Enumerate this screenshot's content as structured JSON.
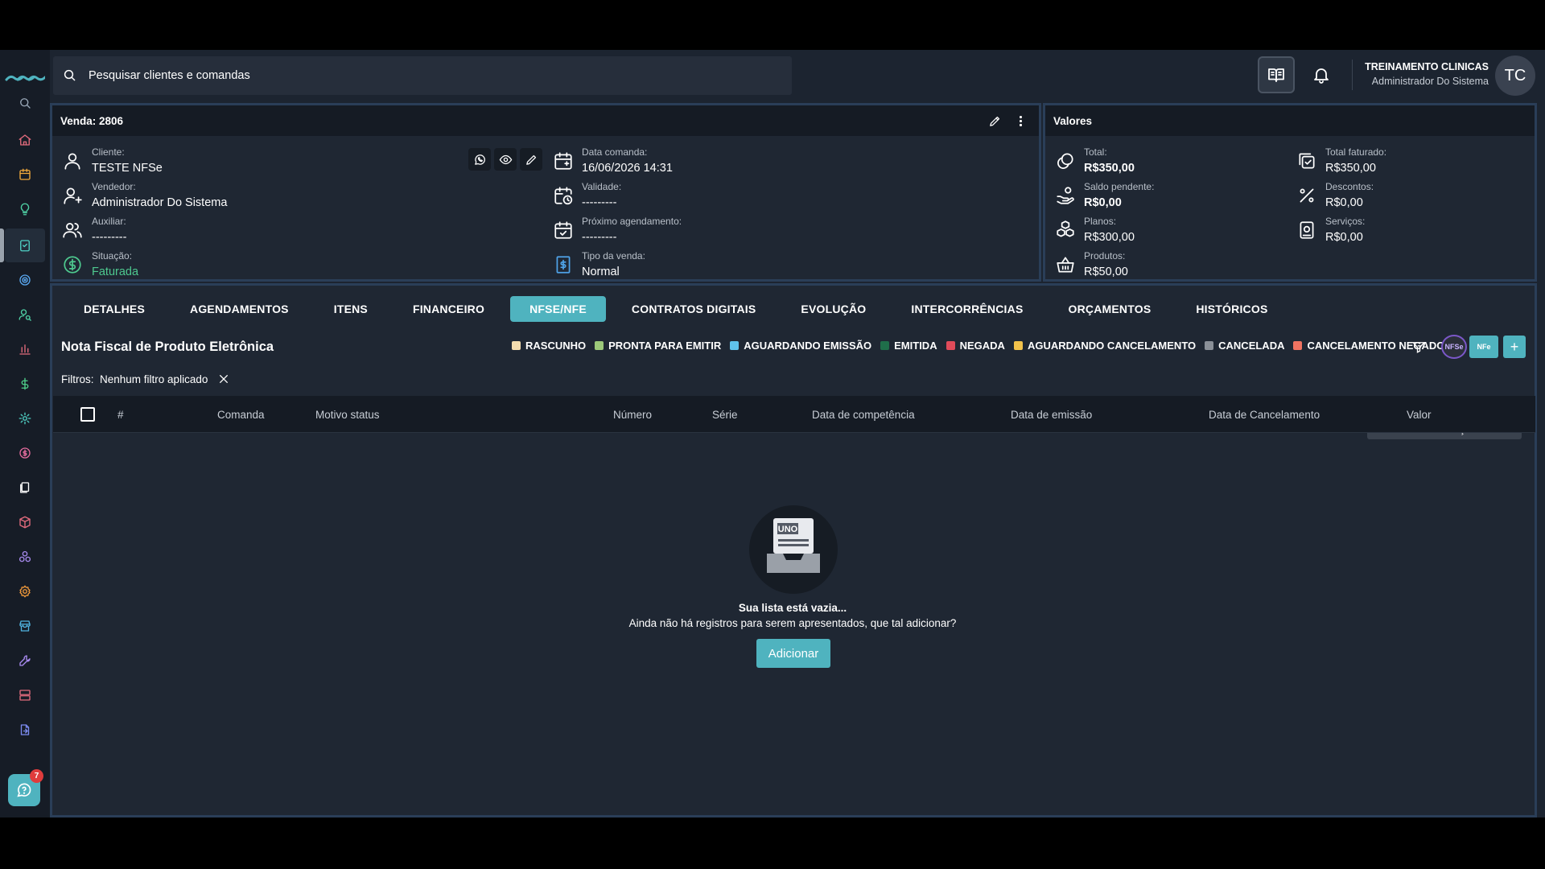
{
  "search": {
    "placeholder": "Pesquisar clientes e comandas"
  },
  "user": {
    "name": "TREINAMENTO CLINICAS",
    "role": "Administrador Do Sistema",
    "initials": "TC"
  },
  "help": {
    "badge_count": "7"
  },
  "sale": {
    "title": "Venda: 2806",
    "client_label": "Cliente:",
    "client_value": "TESTE NFSe",
    "seller_label": "Vendedor:",
    "seller_value": "Administrador Do Sistema",
    "assistant_label": "Auxiliar:",
    "assistant_value": "---------",
    "status_label": "Situação:",
    "status_value": "Faturada",
    "date_label": "Data comanda:",
    "date_value": "16/06/2026 14:31",
    "validity_label": "Validade:",
    "validity_value": "---------",
    "next_label": "Próximo agendamento:",
    "next_value": "---------",
    "type_label": "Tipo da venda:",
    "type_value": "Normal"
  },
  "values": {
    "title": "Valores",
    "total_label": "Total:",
    "total_value": "R$350,00",
    "pending_label": "Saldo pendente:",
    "pending_value": "R$0,00",
    "plans_label": "Planos:",
    "plans_value": "R$300,00",
    "products_label": "Produtos:",
    "products_value": "R$50,00",
    "billed_label": "Total faturado:",
    "billed_value": "R$350,00",
    "discounts_label": "Descontos:",
    "discounts_value": "R$0,00",
    "services_label": "Serviços:",
    "services_value": "R$0,00"
  },
  "tabs": [
    "DETALHES",
    "AGENDAMENTOS",
    "ITENS",
    "FINANCEIRO",
    "NFSE/NFE",
    "CONTRATOS DIGITAIS",
    "EVOLUÇÃO",
    "INTERCORRÊNCIAS",
    "ORÇAMENTOS",
    "HISTÓRICOS"
  ],
  "section_title": "Nota Fiscal de Produto Eletrônica",
  "legend": [
    {
      "label": "RASCUNHO",
      "color": "#f3dcae"
    },
    {
      "label": "PRONTA PARA EMITIR",
      "color": "#9cc97a"
    },
    {
      "label": "AGUARDANDO EMISSÃO",
      "color": "#5fc3ec"
    },
    {
      "label": "EMITIDA",
      "color": "#1f6e4a"
    },
    {
      "label": "NEGADA",
      "color": "#e04b5a"
    },
    {
      "label": "AGUARDANDO CANCELAMENTO",
      "color": "#f2c24b"
    },
    {
      "label": "CANCELADA",
      "color": "#8a9098"
    },
    {
      "label": "CANCELAMENTO NEGADO",
      "color": "#f07361"
    }
  ],
  "buttons": {
    "nfse": "NFSe",
    "nfe": "NFe",
    "add": "+"
  },
  "tooltip": "Nota Fiscal de Serviço Eletrônica",
  "filters": {
    "label": "Filtros:",
    "value": "Nenhum filtro aplicado"
  },
  "table": {
    "columns": [
      "#",
      "Comanda",
      "Motivo status",
      "Número",
      "Série",
      "Data de competência",
      "Data de emissão",
      "Data de Cancelamento",
      "Valor"
    ]
  },
  "empty": {
    "box_label": "UNO",
    "title": "Sua lista está vazia...",
    "subtitle": "Ainda não há registros para serem apresentados, que tal adicionar?",
    "button": "Adicionar"
  },
  "colors": {
    "accent": "#4fb3bf",
    "status_ok": "#4ec98f"
  }
}
